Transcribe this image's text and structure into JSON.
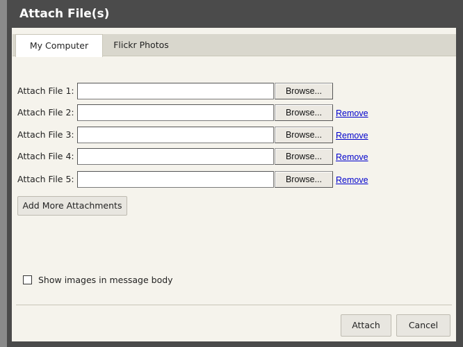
{
  "dialog": {
    "title": "Attach File(s)",
    "tabs": [
      {
        "label": "My Computer",
        "active": true
      },
      {
        "label": "Flickr Photos",
        "active": false
      }
    ],
    "files": [
      {
        "label": "Attach File 1:",
        "value": "",
        "browse": "Browse...",
        "remove": ""
      },
      {
        "label": "Attach File 2:",
        "value": "",
        "browse": "Browse...",
        "remove": "Remove"
      },
      {
        "label": "Attach File 3:",
        "value": "",
        "browse": "Browse...",
        "remove": "Remove"
      },
      {
        "label": "Attach File 4:",
        "value": "",
        "browse": "Browse...",
        "remove": "Remove"
      },
      {
        "label": "Attach File 5:",
        "value": "",
        "browse": "Browse...",
        "remove": "Remove"
      }
    ],
    "add_more_label": "Add More Attachments",
    "show_images_label": "Show images in message body",
    "show_images_checked": false,
    "attach_label": "Attach",
    "cancel_label": "Cancel"
  },
  "colors": {
    "title_bar": "#4b4b4b",
    "content_bg": "#f5f3ec",
    "link": "#0000cc"
  }
}
